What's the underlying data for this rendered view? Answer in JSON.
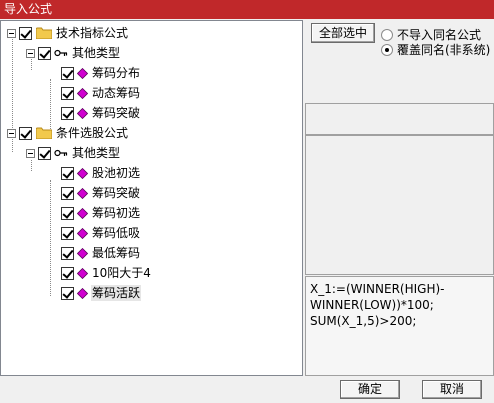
{
  "window": {
    "title": "导入公式"
  },
  "tree": {
    "groups": [
      {
        "label": "技术指标公式",
        "subgroup": "其他类型",
        "items": [
          "筹码分布",
          "动态筹码",
          "筹码突破"
        ]
      },
      {
        "label": "条件选股公式",
        "subgroup": "其他类型",
        "items": [
          "股池初选",
          "筹码突破",
          "筹码初选",
          "筹码低吸",
          "最低筹码",
          "10阳大于4",
          "筹码活跃"
        ]
      }
    ],
    "selected_item": "筹码活跃"
  },
  "options": {
    "select_all_label": "全部选中",
    "radio_skip_label": "不导入同名公式",
    "radio_overwrite_label": "覆盖同名(非系统)",
    "radio_selected": "覆盖同名(非系统)"
  },
  "formula_text": "X_1:=(WINNER(HIGH)-\nWINNER(LOW))*100;\nSUM(X_1,5)>200;",
  "buttons": {
    "ok_label": "确定",
    "cancel_label": "取消"
  },
  "colors": {
    "titlebar": "#c0282a",
    "diamond": "#d000d0",
    "folder": "#f2c94c"
  }
}
